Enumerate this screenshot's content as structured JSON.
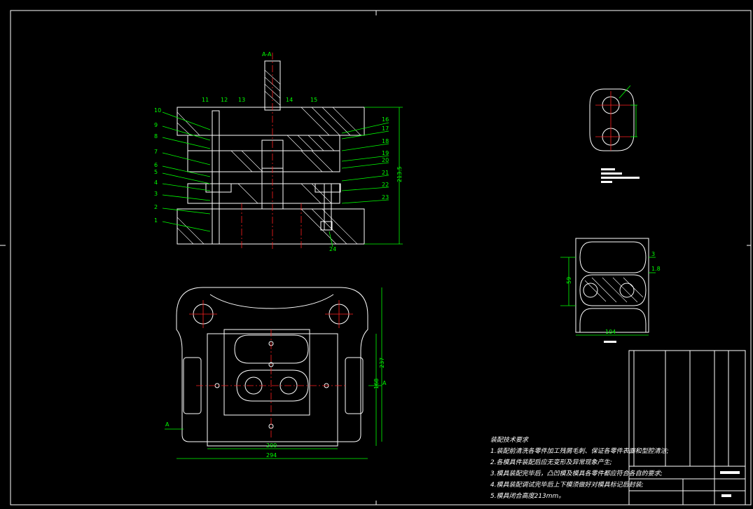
{
  "drawing": {
    "section_title": "A-A",
    "section_mark": "A",
    "part_numbers_left": [
      "10",
      "9",
      "8",
      "7",
      "6",
      "5",
      "4",
      "3",
      "2",
      "1"
    ],
    "part_numbers_top": [
      "11",
      "12",
      "13",
      "14",
      "15"
    ],
    "part_numbers_right": [
      "16",
      "17",
      "18",
      "19",
      "20",
      "21",
      "22",
      "23"
    ],
    "part_number_bottom": "24",
    "dim_height": "213.5",
    "dim_plan_width_outer": "294",
    "dim_plan_width_inner": "200",
    "dim_plan_height_outer": "237",
    "dim_plan_height_inner": "168",
    "dim_strip_height": "59",
    "dim_strip_length": "104",
    "dim_strip_small_1": "3",
    "dim_strip_small_2": "1.8"
  },
  "notes": {
    "heading": "装配技术要求",
    "lines": [
      "1.装配前清洗各零件加工残屑毛刺、保证各零件表面和型腔清洁;",
      "2.各模具件装配后应无变形及异常现象产生;",
      "3.模具装配完毕后，凸凹模及模具各零件都应符合各自的要求;",
      "4.模具装配调试完毕后上下模须做好对模具标记后封装;",
      "5.模具闭合高度213mm。"
    ]
  }
}
